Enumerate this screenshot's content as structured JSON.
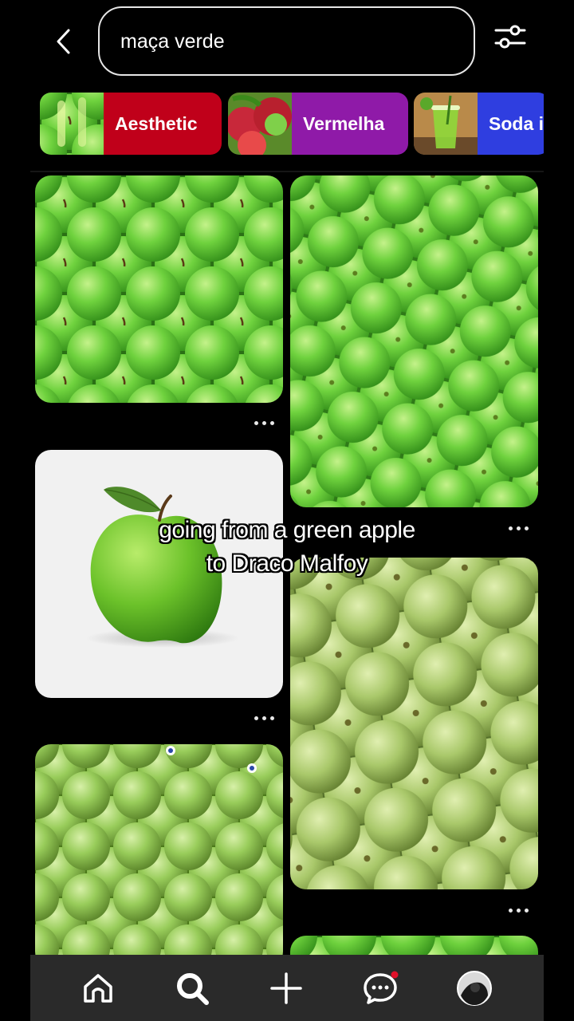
{
  "search": {
    "query": "maça verde"
  },
  "chips": [
    {
      "label": "Aesthetic",
      "color": "#c0001a"
    },
    {
      "label": "Vermelha",
      "color": "#8f1aa8"
    },
    {
      "label": "Soda i",
      "color": "#2f3ee0"
    }
  ],
  "caption": {
    "line1": "going from a green apple",
    "line2": "to Draco Malfoy"
  },
  "colors": {
    "background": "#000000",
    "nav_background": "#2a2a2a",
    "apple_green": "#6dc840",
    "notification_dot": "#e0102a"
  },
  "nav": {
    "items": [
      "home-icon",
      "search-icon",
      "plus-icon",
      "chat-icon",
      "profile-avatar"
    ]
  }
}
